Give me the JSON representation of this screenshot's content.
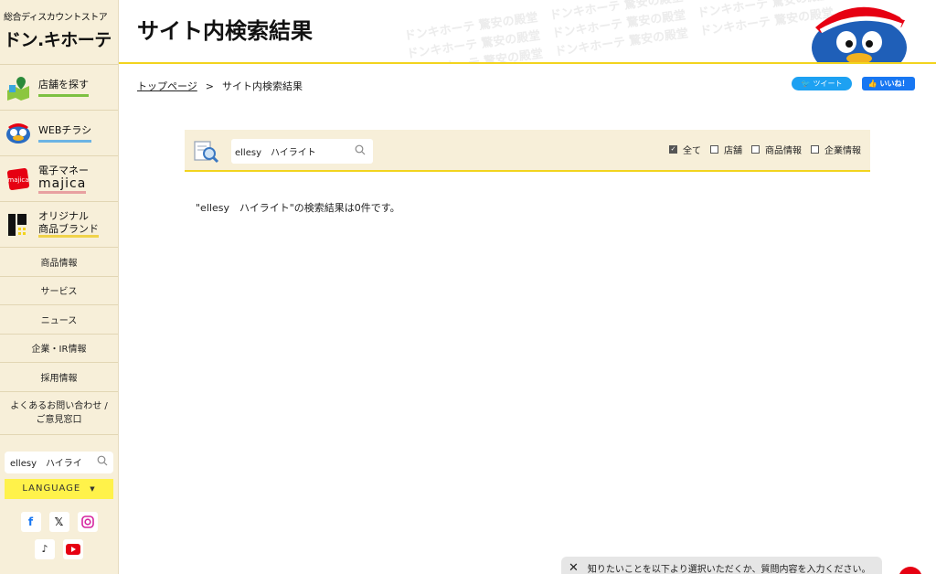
{
  "sidebar": {
    "logo_sub": "総合ディスカウントストア",
    "logo_main": "ドン.キホーテ",
    "big_items": [
      {
        "label": "店舗を探す",
        "icon": "store-map-icon"
      },
      {
        "label": "WEBチラシ",
        "icon": "flyer-mascot-icon"
      },
      {
        "label": "電子マネー",
        "label2": "majica",
        "icon": "majica-card-icon"
      },
      {
        "label": "オリジナル",
        "label2": "商品ブランド",
        "icon": "original-brand-icon"
      }
    ],
    "small_items": [
      "商品情報",
      "サービス",
      "ニュース",
      "企業・IR情報",
      "採用情報"
    ],
    "faq_line1": "よくあるお問い合わせ /",
    "faq_line2": "ご意見窓口",
    "search_value": "ellesy　ハイライ",
    "language_label": "LANGUAGE",
    "social": [
      "facebook-icon",
      "x-icon",
      "instagram-icon",
      "tiktok-icon",
      "youtube-icon"
    ]
  },
  "header": {
    "title": "サイト内検索結果",
    "watermark": "ドンキホーテ 驚安の殿堂"
  },
  "breadcrumb": {
    "home": "トップページ",
    "sep": ">",
    "current": "サイト内検索結果"
  },
  "share": {
    "tweet": "ツイート",
    "like": "いいね！"
  },
  "search_panel": {
    "value": "ellesy　ハイライト",
    "filters": [
      {
        "label": "全て",
        "checked": true
      },
      {
        "label": "店舗",
        "checked": false
      },
      {
        "label": "商品情報",
        "checked": false
      },
      {
        "label": "企業情報",
        "checked": false
      }
    ]
  },
  "result_text": "\"ellesy　ハイライト\"の検索結果は0件です。",
  "chat": {
    "text": "知りたいことを以下より選択いただくか、質問内容を入力ください。"
  },
  "colors": {
    "sidebar_bg": "#f7efd9",
    "accent_yellow": "#f2d41e",
    "language_bg": "#fff24a",
    "twitter": "#1da1f2",
    "facebook": "#1877f2"
  }
}
